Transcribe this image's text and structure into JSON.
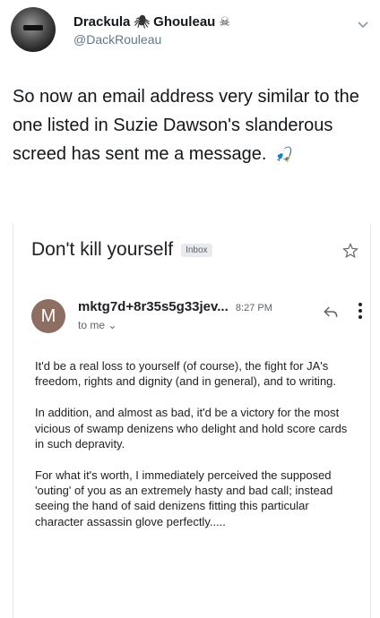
{
  "tweet": {
    "display_name_first": "Drackula",
    "spider_glyph": "🕷",
    "display_name_second": "Ghouleau",
    "skull_glyph": "☠",
    "handle": "@DackRouleau",
    "text": "So now an email address very similar to the one listed in Suzie Dawson's slanderous screed has sent me a message.",
    "emoji": "🎣"
  },
  "email": {
    "subject": "Don't kill yourself",
    "inbox_label": "Inbox",
    "sender_initial": "M",
    "sender": "mktg7d+8r35s5g33jev...",
    "time": "8:27 PM",
    "to_label": "to me",
    "body": [
      "It'd be a real loss to yourself (of course), the fight for JA's freedom, rights and dignity (and in general), and to writing.",
      "In addition, and almost as bad, it'd be a victory for the most vicious of swamp denizens who delight and hold score cards in such depravity.",
      "For what it's worth, I immediately perceived the supposed 'outing' of you as an extremely hasty and bad call; instead seeing the hand of said denizens fitting this particular character assassin glove perfectly....."
    ]
  },
  "colors": {
    "sender_avatar": "#8d6e63",
    "handle": "#657786",
    "badge_bg": "#e8eaed"
  },
  "icons": [
    "chevron-down-icon",
    "star-icon",
    "reply-icon",
    "more-vert-icon"
  ]
}
